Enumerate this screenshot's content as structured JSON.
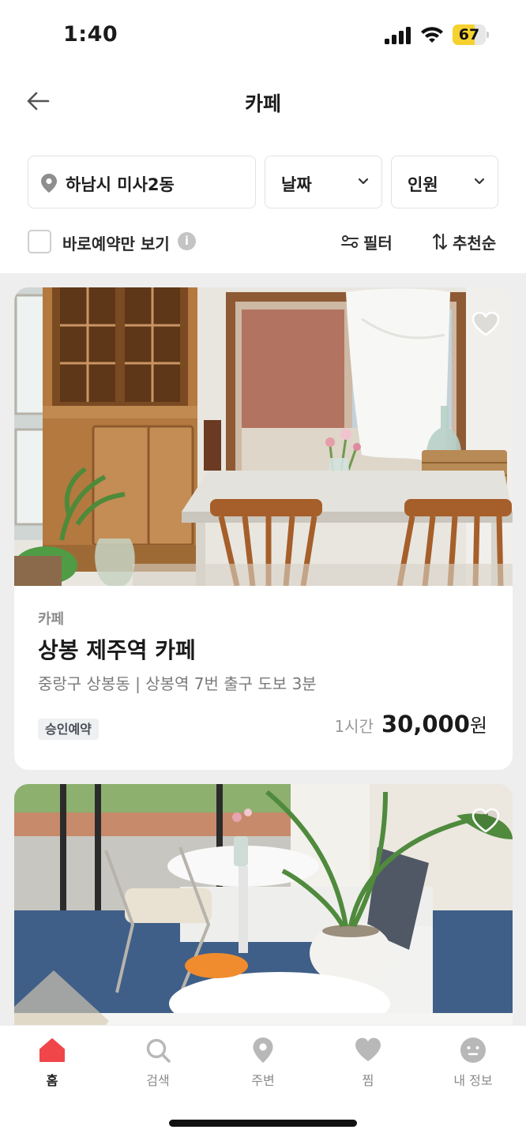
{
  "status_bar": {
    "time": "1:40",
    "battery_level": "67",
    "battery_fraction": 0.67,
    "battery_color": "#f6d12f"
  },
  "header": {
    "back_icon": "arrow-left-icon",
    "title": "카페"
  },
  "filters": {
    "location_icon": "map-pin-icon",
    "location": "하남시 미사2동",
    "date": "날짜",
    "people": "인원"
  },
  "options": {
    "instant_booking_label": "바로예약만 보기",
    "info_icon": "info-icon",
    "info_glyph": "i",
    "filter_label": "필터",
    "filter_icon": "sliders-icon",
    "sort_label": "추천순",
    "sort_icon": "sort-arrows-icon"
  },
  "listings": [
    {
      "category": "카페",
      "title": "상봉 제주역 카페",
      "address": "중랑구 상봉동 | 상봉역 7번 출구 도보 3분",
      "badge": "승인예약",
      "price_unit": "1시간",
      "price": "30,000",
      "currency": "원",
      "favorite_icon": "heart-outline-icon"
    },
    {
      "favorite_icon": "heart-outline-icon"
    }
  ],
  "bottom_nav": [
    {
      "label": "홈",
      "icon": "home-icon",
      "active": true
    },
    {
      "label": "검색",
      "icon": "search-icon",
      "active": false
    },
    {
      "label": "주변",
      "icon": "location-pin-icon",
      "active": false
    },
    {
      "label": "찜",
      "icon": "heart-icon",
      "active": false
    },
    {
      "label": "내 정보",
      "icon": "profile-face-icon",
      "active": false
    }
  ],
  "colors": {
    "accent": "#f0464a",
    "inactive_icon": "#b8b8b8",
    "list_background": "#eeeeee"
  }
}
